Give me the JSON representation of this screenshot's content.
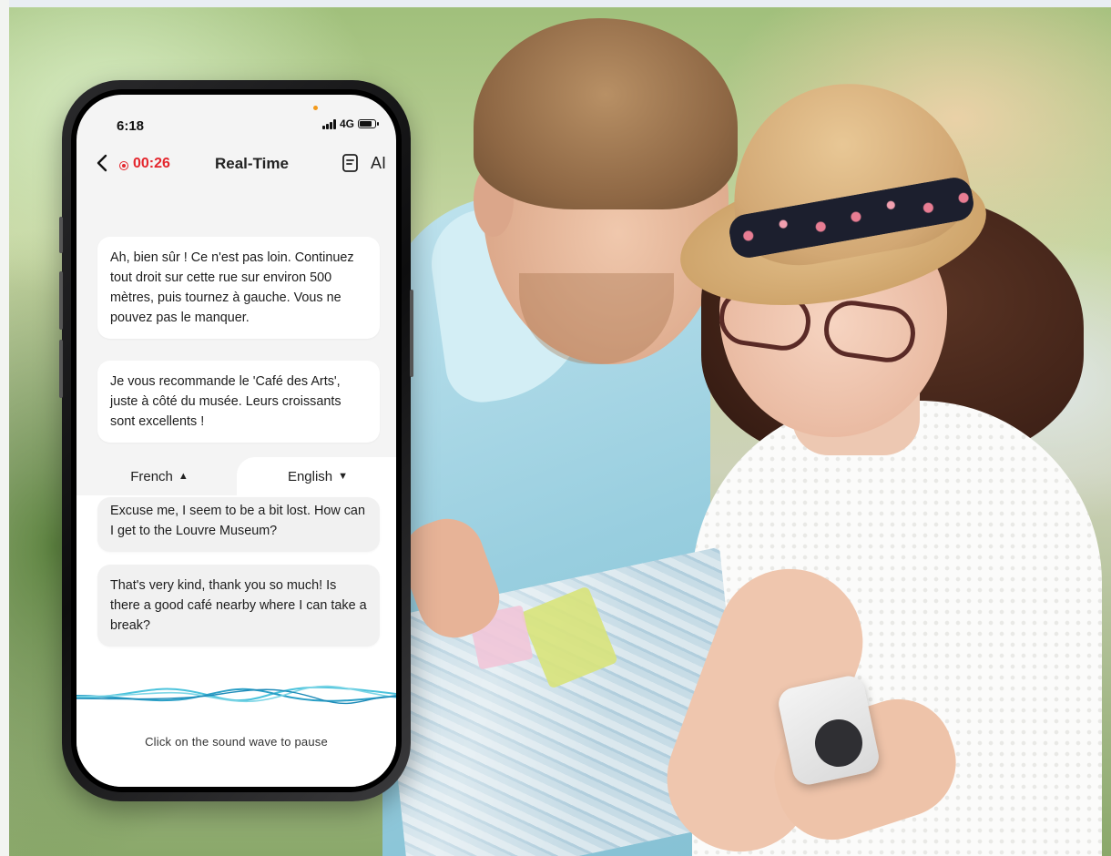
{
  "status_bar": {
    "time": "6:18",
    "network": "4G",
    "icons": [
      "signal-icon",
      "battery-icon"
    ]
  },
  "nav": {
    "recording_time": "00:26",
    "title": "Real-Time",
    "right_text": "AI",
    "icons": [
      "back-icon",
      "record-icon",
      "document-icon"
    ]
  },
  "messages_source": [
    {
      "text": "Ah, bien sûr ! Ce n'est pas loin. Continuez tout droit sur cette rue sur environ 500 mètres, puis tournez à gauche. Vous ne pouvez pas le manquer."
    },
    {
      "text": "Je vous recommande le 'Café des Arts', juste à côté du musée. Leurs croissants sont excellents !"
    }
  ],
  "languages": {
    "source": "French",
    "source_arrow": "▲",
    "target": "English",
    "target_arrow": "▼"
  },
  "messages_target": [
    {
      "text": "Excuse me, I seem to be a bit lost. How can I get to the Louvre Museum?"
    },
    {
      "text": "That's very kind, thank you so much! Is there a good café nearby where I can take a break?"
    }
  ],
  "hint": "Click on the sound wave to pause",
  "colors": {
    "recording": "#e4262d",
    "wave_primary": "#3fb7d6",
    "wave_secondary": "#2a9fc6",
    "screen_bg": "#f4f4f4"
  }
}
